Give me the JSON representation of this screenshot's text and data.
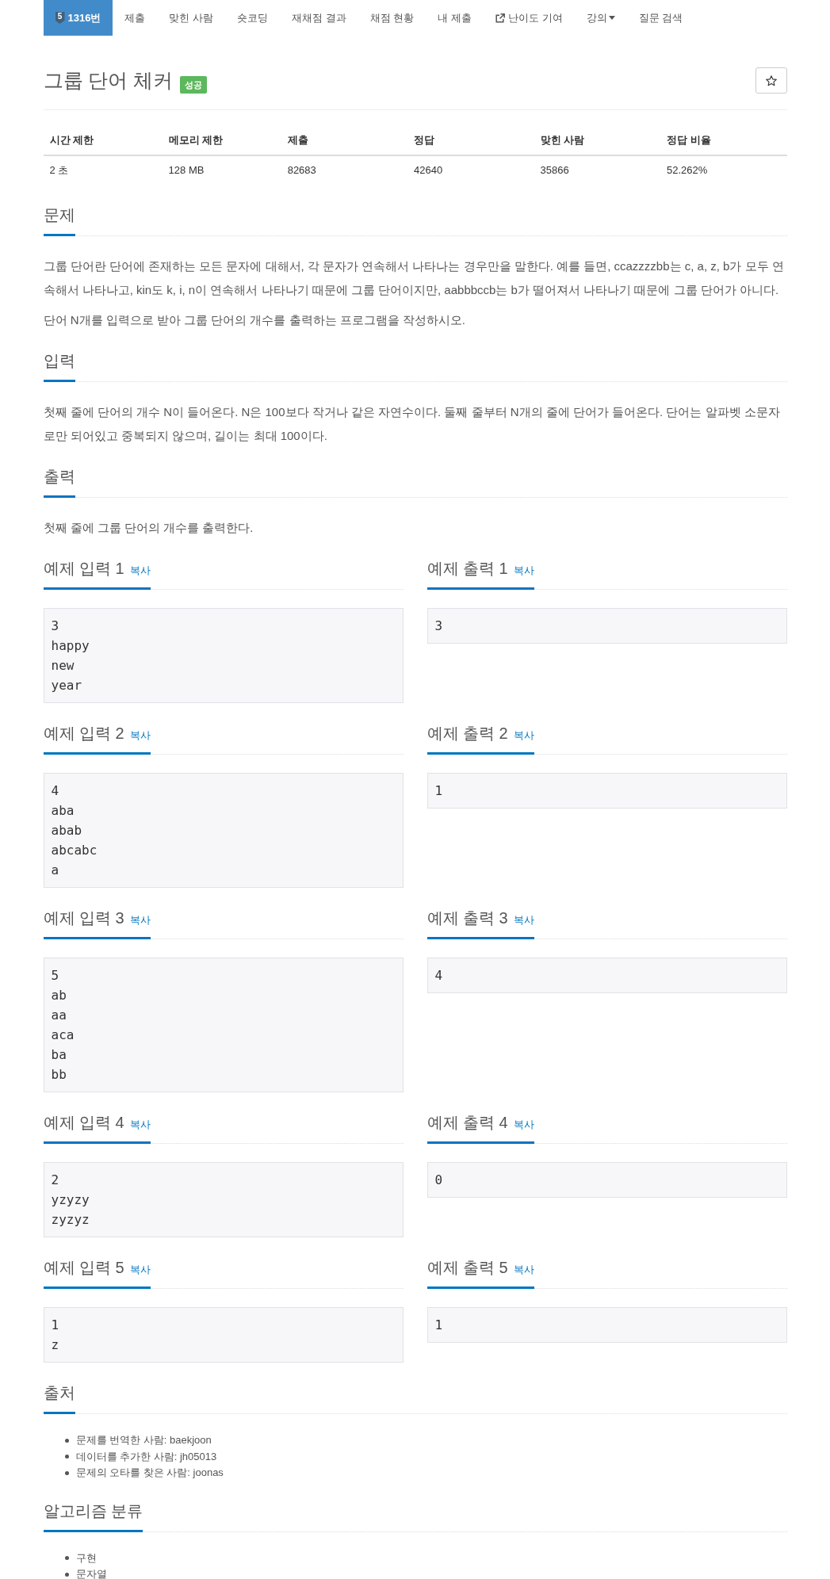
{
  "nav": {
    "items": [
      {
        "kind": "problem",
        "tier": "5",
        "label": "1316번",
        "selected": true
      },
      {
        "kind": "link",
        "label": "제출",
        "selected": false
      },
      {
        "kind": "link",
        "label": "맞힌 사람",
        "selected": false
      },
      {
        "kind": "link",
        "label": "숏코딩",
        "selected": false
      },
      {
        "kind": "link",
        "label": "재채점 결과",
        "selected": false
      },
      {
        "kind": "link",
        "label": "채점 현황",
        "selected": false
      },
      {
        "kind": "link",
        "label": "내 제출",
        "selected": false
      },
      {
        "kind": "external",
        "label": "난이도 기여",
        "selected": false
      },
      {
        "kind": "dropdown",
        "label": "강의",
        "selected": false
      },
      {
        "kind": "link",
        "label": "질문 검색",
        "selected": false
      }
    ]
  },
  "problem": {
    "title": "그룹 단어 체커",
    "result_badge": "성공",
    "starred": false
  },
  "stats": {
    "columns": [
      "시간 제한",
      "메모리 제한",
      "제출",
      "정답",
      "맞힌 사람",
      "정답 비율"
    ],
    "rows": [
      [
        "2 초",
        "128 MB",
        "82683",
        "42640",
        "35866",
        "52.262%"
      ]
    ]
  },
  "sections": [
    {
      "heading": "문제",
      "paragraphs": [
        "그룹 단어란 단어에 존재하는 모든 문자에 대해서, 각 문자가 연속해서 나타나는 경우만을 말한다. 예를 들면, ccazzzzbb는 c, a, z, b가 모두 연속해서 나타나고, kin도 k, i, n이 연속해서 나타나기 때문에 그룹 단어이지만, aabbbccb는 b가 떨어져서 나타나기 때문에 그룹 단어가 아니다.",
        "단어 N개를 입력으로 받아 그룹 단어의 개수를 출력하는 프로그램을 작성하시오."
      ]
    },
    {
      "heading": "입력",
      "paragraphs": [
        "첫째 줄에 단어의 개수 N이 들어온다. N은 100보다 작거나 같은 자연수이다. 둘째 줄부터 N개의 줄에 단어가 들어온다. 단어는 알파벳 소문자로만 되어있고 중복되지 않으며, 길이는 최대 100이다."
      ]
    },
    {
      "heading": "출력",
      "paragraphs": [
        "첫째 줄에 그룹 단어의 개수를 출력한다."
      ]
    }
  ],
  "samples": [
    {
      "input_heading": "예제 입력 1",
      "input_copy": "복사",
      "input": "3\nhappy\nnew\nyear",
      "output_heading": "예제 출력 1",
      "output_copy": "복사",
      "output": "3"
    },
    {
      "input_heading": "예제 입력 2",
      "input_copy": "복사",
      "input": "4\naba\nabab\nabcabc\na",
      "output_heading": "예제 출력 2",
      "output_copy": "복사",
      "output": "1"
    },
    {
      "input_heading": "예제 입력 3",
      "input_copy": "복사",
      "input": "5\nab\naa\naca\nba\nbb",
      "output_heading": "예제 출력 3",
      "output_copy": "복사",
      "output": "4"
    },
    {
      "input_heading": "예제 입력 4",
      "input_copy": "복사",
      "input": "2\nyzyzy\nzyzyz",
      "output_heading": "예제 출력 4",
      "output_copy": "복사",
      "output": "0"
    },
    {
      "input_heading": "예제 입력 5",
      "input_copy": "복사",
      "input": "1\nz",
      "output_heading": "예제 출력 5",
      "output_copy": "복사",
      "output": "1"
    }
  ],
  "source": {
    "heading": "출처",
    "items": [
      {
        "label": "문제를 번역한 사람:",
        "user": "baekjoon"
      },
      {
        "label": "데이터를 추가한 사람:",
        "user": "jh05013"
      },
      {
        "label": "문제의 오타를 찾은 사람:",
        "user": "joonas"
      }
    ]
  },
  "algorithms": {
    "heading": "알고리즘 분류",
    "tags": [
      "구현",
      "문자열"
    ]
  }
}
